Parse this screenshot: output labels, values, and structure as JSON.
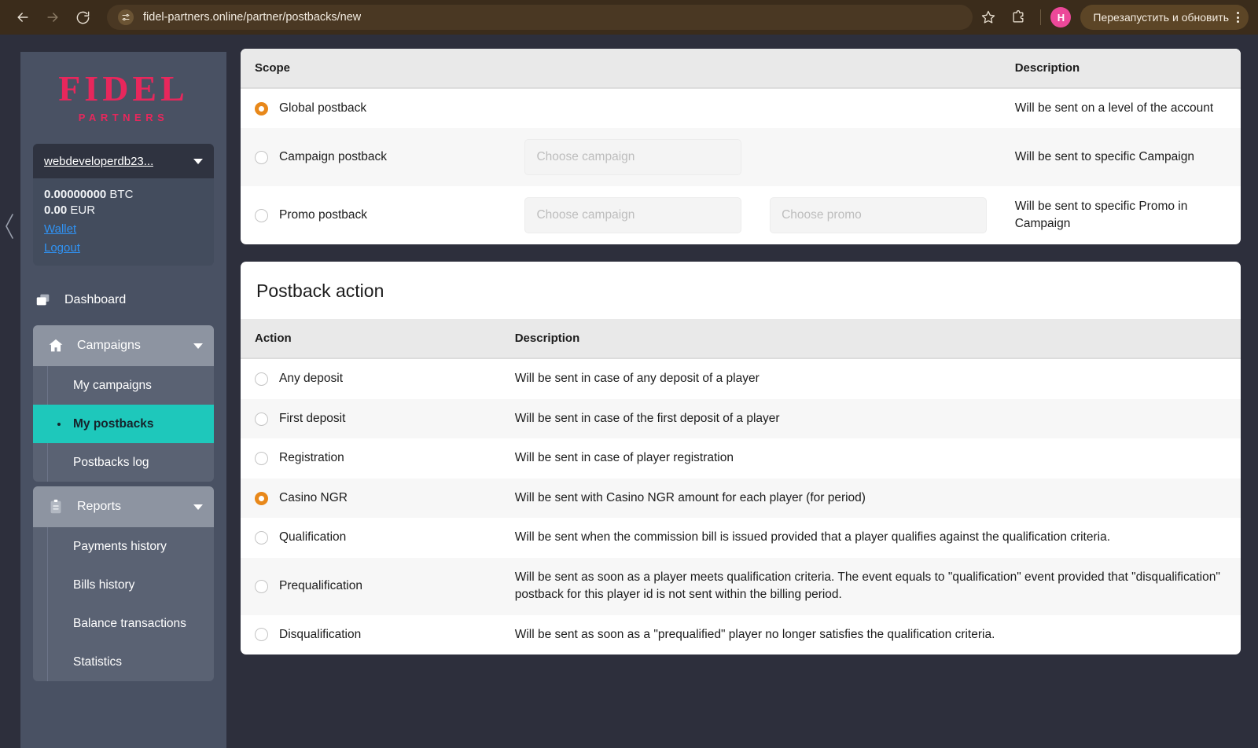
{
  "browser": {
    "url": "fidel-partners.online/partner/postbacks/new",
    "back_label": "Back",
    "forward_label": "Forward",
    "reload_label": "Reload",
    "site_info_icon": "site-settings-icon",
    "bookmark_icon": "star-icon",
    "extensions_icon": "extensions-icon",
    "profile_initial": "H",
    "relaunch_label": "Перезапустить и обновить",
    "menu_icon": "kebab-menu-icon"
  },
  "sidebar": {
    "logo_main": "FIDEL",
    "logo_sub": "PARTNERS",
    "account_name": "webdeveloperdb23...",
    "balances": [
      {
        "amount": "0.00000000",
        "currency": "BTC"
      },
      {
        "amount": "0.00",
        "currency": "EUR"
      }
    ],
    "links": [
      {
        "label": "Wallet",
        "name": "wallet-link"
      },
      {
        "label": "Logout",
        "name": "logout-link"
      }
    ],
    "nav": {
      "dashboard": {
        "label": "Dashboard",
        "icon": "windows-icon"
      },
      "campaigns": {
        "label": "Campaigns",
        "icon": "home-icon",
        "items": [
          {
            "label": "My campaigns",
            "active": false
          },
          {
            "label": "My postbacks",
            "active": true
          },
          {
            "label": "Postbacks log",
            "active": false
          }
        ]
      },
      "reports": {
        "label": "Reports",
        "icon": "clipboard-icon",
        "items": [
          {
            "label": "Payments history",
            "active": false
          },
          {
            "label": "Bills history",
            "active": false
          },
          {
            "label": "Balance transactions",
            "active": false
          },
          {
            "label": "Statistics",
            "active": false
          }
        ]
      }
    },
    "collapse_icon": "chevron-left-icon"
  },
  "scope_card": {
    "columns": {
      "scope": "Scope",
      "description": "Description"
    },
    "rows": [
      {
        "label": "Global postback",
        "selected": true,
        "description": "Will be sent on a level of the account",
        "selects": []
      },
      {
        "label": "Campaign postback",
        "selected": false,
        "description": "Will be sent to specific Campaign",
        "selects": [
          {
            "placeholder": "Choose campaign",
            "name": "choose-campaign-select"
          }
        ]
      },
      {
        "label": "Promo postback",
        "selected": false,
        "description": "Will be sent to specific Promo in Campaign",
        "selects": [
          {
            "placeholder": "Choose campaign",
            "name": "choose-campaign-select"
          },
          {
            "placeholder": "Choose promo",
            "name": "choose-promo-select"
          }
        ]
      }
    ]
  },
  "action_card": {
    "title": "Postback action",
    "columns": {
      "action": "Action",
      "description": "Description"
    },
    "rows": [
      {
        "label": "Any deposit",
        "selected": false,
        "description": "Will be sent in case of any deposit of a player"
      },
      {
        "label": "First deposit",
        "selected": false,
        "description": "Will be sent in case of the first deposit of a player"
      },
      {
        "label": "Registration",
        "selected": false,
        "description": "Will be sent in case of player registration"
      },
      {
        "label": "Casino NGR",
        "selected": true,
        "description": "Will be sent with Casino NGR amount for each player (for period)"
      },
      {
        "label": "Qualification",
        "selected": false,
        "description": "Will be sent when the commission bill is issued provided that a player qualifies against the qualification criteria."
      },
      {
        "label": "Prequalification",
        "selected": false,
        "description": "Will be sent as soon as a player meets qualification criteria. The event equals to \"qualification\" event provided that \"disqualification\" postback for this player id is not sent within the billing period."
      },
      {
        "label": "Disqualification",
        "selected": false,
        "description": "Will be sent as soon as a \"prequalified\" player no longer satisfies the qualification criteria."
      }
    ]
  },
  "colors": {
    "accent_pink": "#e8275c",
    "accent_teal": "#1ec8bb",
    "radio_orange": "#e8881a",
    "link_blue": "#2f93f5",
    "page_bg": "#2d2f3c",
    "sidebar_bg": "#495163"
  }
}
